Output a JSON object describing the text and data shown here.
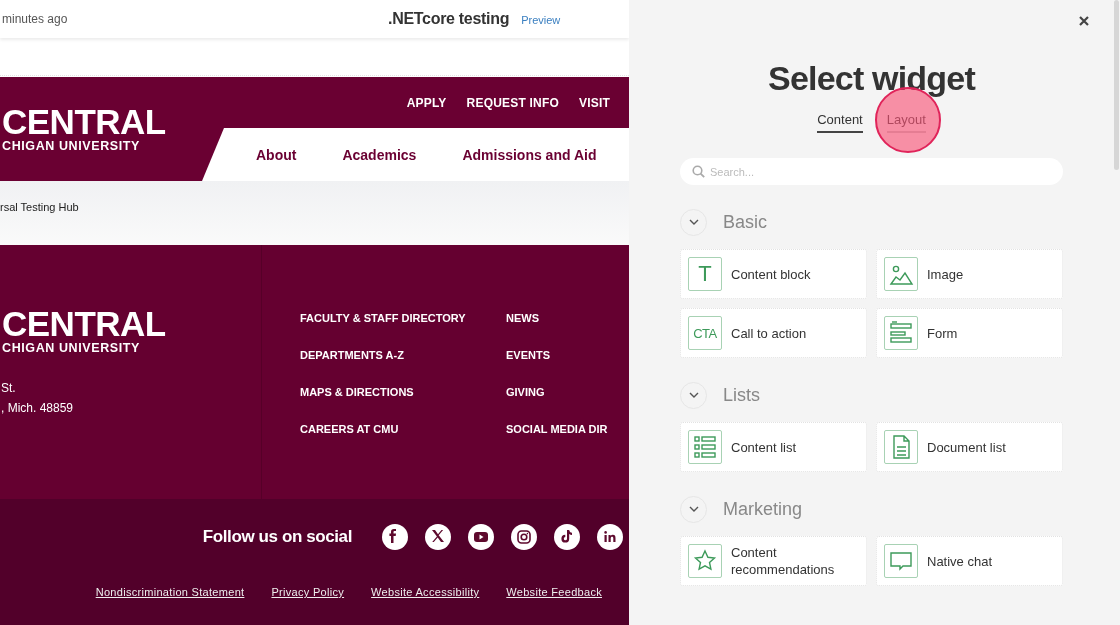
{
  "top_bar": {
    "edited": "minutes ago",
    "page_title": ".NETcore testing",
    "preview_link": "Preview"
  },
  "site_header": {
    "logo_lines": [
      "CENTRAL",
      "CHIGAN UNIVERSITY"
    ],
    "utility_links": [
      "APPLY",
      "REQUEST INFO",
      "VISIT"
    ],
    "nav_items": [
      "About",
      "Academics",
      "Admissions and Aid"
    ]
  },
  "breadcrumb": "rsal Testing Hub",
  "footer": {
    "logo_lines": [
      "CENTRAL",
      "CHIGAN UNIVERSITY"
    ],
    "address_lines": [
      "St.",
      ", Mich. 48859"
    ],
    "link_columns": [
      [
        "FACULTY & STAFF DIRECTORY",
        "DEPARTMENTS A-Z",
        "MAPS & DIRECTIONS",
        "CAREERS AT CMU"
      ],
      [
        "NEWS",
        "EVENTS",
        "GIVING",
        "SOCIAL MEDIA DIR"
      ]
    ],
    "social_heading": "Follow us on social",
    "social_icons": [
      {
        "kind": "facebook"
      },
      {
        "kind": "x"
      },
      {
        "kind": "youtube"
      },
      {
        "kind": "instagram"
      },
      {
        "kind": "tiktok"
      },
      {
        "kind": "linkedin"
      }
    ],
    "legal_links": [
      "Nondiscrimination Statement",
      "Privacy Policy",
      "Website Accessibility",
      "Website Feedback"
    ]
  },
  "panel": {
    "title": "Select widget",
    "tabs": [
      {
        "label": "Content",
        "selected": true,
        "clicked": false
      },
      {
        "label": "Layout",
        "selected": false,
        "clicked": true
      }
    ],
    "search": {
      "placeholder": "Search..."
    },
    "sections": [
      {
        "title": "Basic",
        "expanded": true,
        "widgets": [
          {
            "label": "Content block",
            "kind": "letter",
            "icon_text": "T"
          },
          {
            "label": "Image",
            "kind": "image"
          },
          {
            "label": "Call to action",
            "kind": "abbreviation",
            "icon_text": "CTA"
          },
          {
            "label": "Form",
            "kind": "form"
          }
        ]
      },
      {
        "title": "Lists",
        "expanded": true,
        "widgets": [
          {
            "label": "Content list",
            "kind": "list"
          },
          {
            "label": "Document list",
            "kind": "document"
          }
        ]
      },
      {
        "title": "Marketing",
        "expanded": true,
        "widgets": [
          {
            "label": "Content recommendations",
            "kind": "star"
          },
          {
            "label": "Native chat",
            "kind": "chat"
          }
        ]
      }
    ]
  }
}
